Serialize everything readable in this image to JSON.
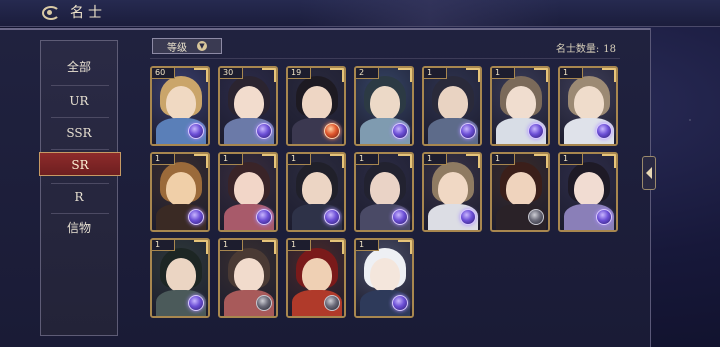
{
  "header": {
    "title": "名士"
  },
  "sidebar": {
    "items": [
      {
        "label": "全部",
        "active": false
      },
      {
        "label": "UR",
        "active": false
      },
      {
        "label": "SSR",
        "active": false
      },
      {
        "label": "SR",
        "active": true
      },
      {
        "label": "R",
        "active": false
      },
      {
        "label": "信物",
        "active": false
      }
    ]
  },
  "toolbar": {
    "sort_label": "等级",
    "count_label": "名士数量:",
    "count_value": "18"
  },
  "cards": [
    {
      "level": "60",
      "orb": "purple"
    },
    {
      "level": "30",
      "orb": "purple"
    },
    {
      "level": "19",
      "orb": "red"
    },
    {
      "level": "2",
      "orb": "purple"
    },
    {
      "level": "1",
      "orb": "purple"
    },
    {
      "level": "1",
      "orb": "purple"
    },
    {
      "level": "1",
      "orb": "purple"
    },
    {
      "level": "1",
      "orb": "purple"
    },
    {
      "level": "1",
      "orb": "purple"
    },
    {
      "level": "1",
      "orb": "purple"
    },
    {
      "level": "1",
      "orb": "purple"
    },
    {
      "level": "1",
      "orb": "purple"
    },
    {
      "level": "1",
      "orb": "dark"
    },
    {
      "level": "1",
      "orb": "purple"
    },
    {
      "level": "1",
      "orb": "purple"
    },
    {
      "level": "1",
      "orb": "dark"
    },
    {
      "level": "1",
      "orb": "dark"
    },
    {
      "level": "1",
      "orb": "purple"
    }
  ],
  "colors": {
    "accent_red": "#8d2b2b",
    "card_border": "#a8874f",
    "panel_bg": "#1a1b36"
  },
  "icons": [
    "game-logo-icon",
    "chevron-down-icon",
    "page-arrow-icon",
    "orb-icon"
  ]
}
